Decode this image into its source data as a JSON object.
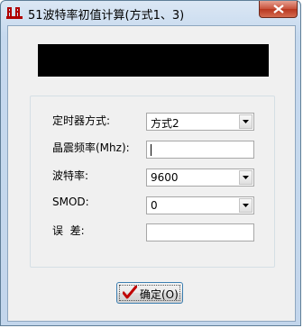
{
  "window": {
    "title": "51波特率初值计算(方式1、3)"
  },
  "form": {
    "mode": {
      "label": "定时器方式:",
      "value": "方式2"
    },
    "crystal": {
      "label": "晶震频率(Mhz):",
      "value": ""
    },
    "baud": {
      "label": "波特率:",
      "value": "9600"
    },
    "smod": {
      "label": "SMOD:",
      "value": "0"
    },
    "error": {
      "label": "误  差:",
      "value": ""
    }
  },
  "ok_button": {
    "label": "确定(O)"
  },
  "icons": {
    "app": "app-icon",
    "close": "close-icon",
    "check": "check-icon",
    "dropdown": "dropdown-arrow-icon"
  },
  "colors": {
    "display": "#000000",
    "close": "#c7513a",
    "check": "#c00000"
  }
}
